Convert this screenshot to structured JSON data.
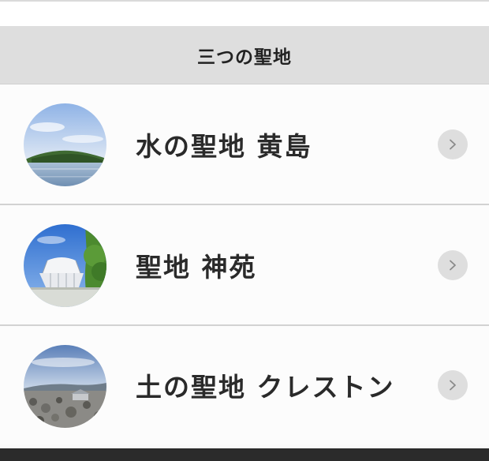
{
  "section": {
    "title": "三つの聖地"
  },
  "items": [
    {
      "label": "水の聖地 黄島",
      "image": "island-over-sea",
      "chevron": "chevron-right-icon"
    },
    {
      "label": "聖地 神苑",
      "image": "white-sanctuary-building",
      "chevron": "chevron-right-icon"
    },
    {
      "label": "土の聖地 クレストン",
      "image": "rocky-field-landscape",
      "chevron": "chevron-right-icon"
    }
  ],
  "colors": {
    "header_bg": "#dedede",
    "row_bg": "#fcfcfc",
    "divider": "#d2d2d2",
    "chevron_bg": "#dedede",
    "text": "#2a2a2a",
    "bottom_bar": "#2b2b2b"
  }
}
